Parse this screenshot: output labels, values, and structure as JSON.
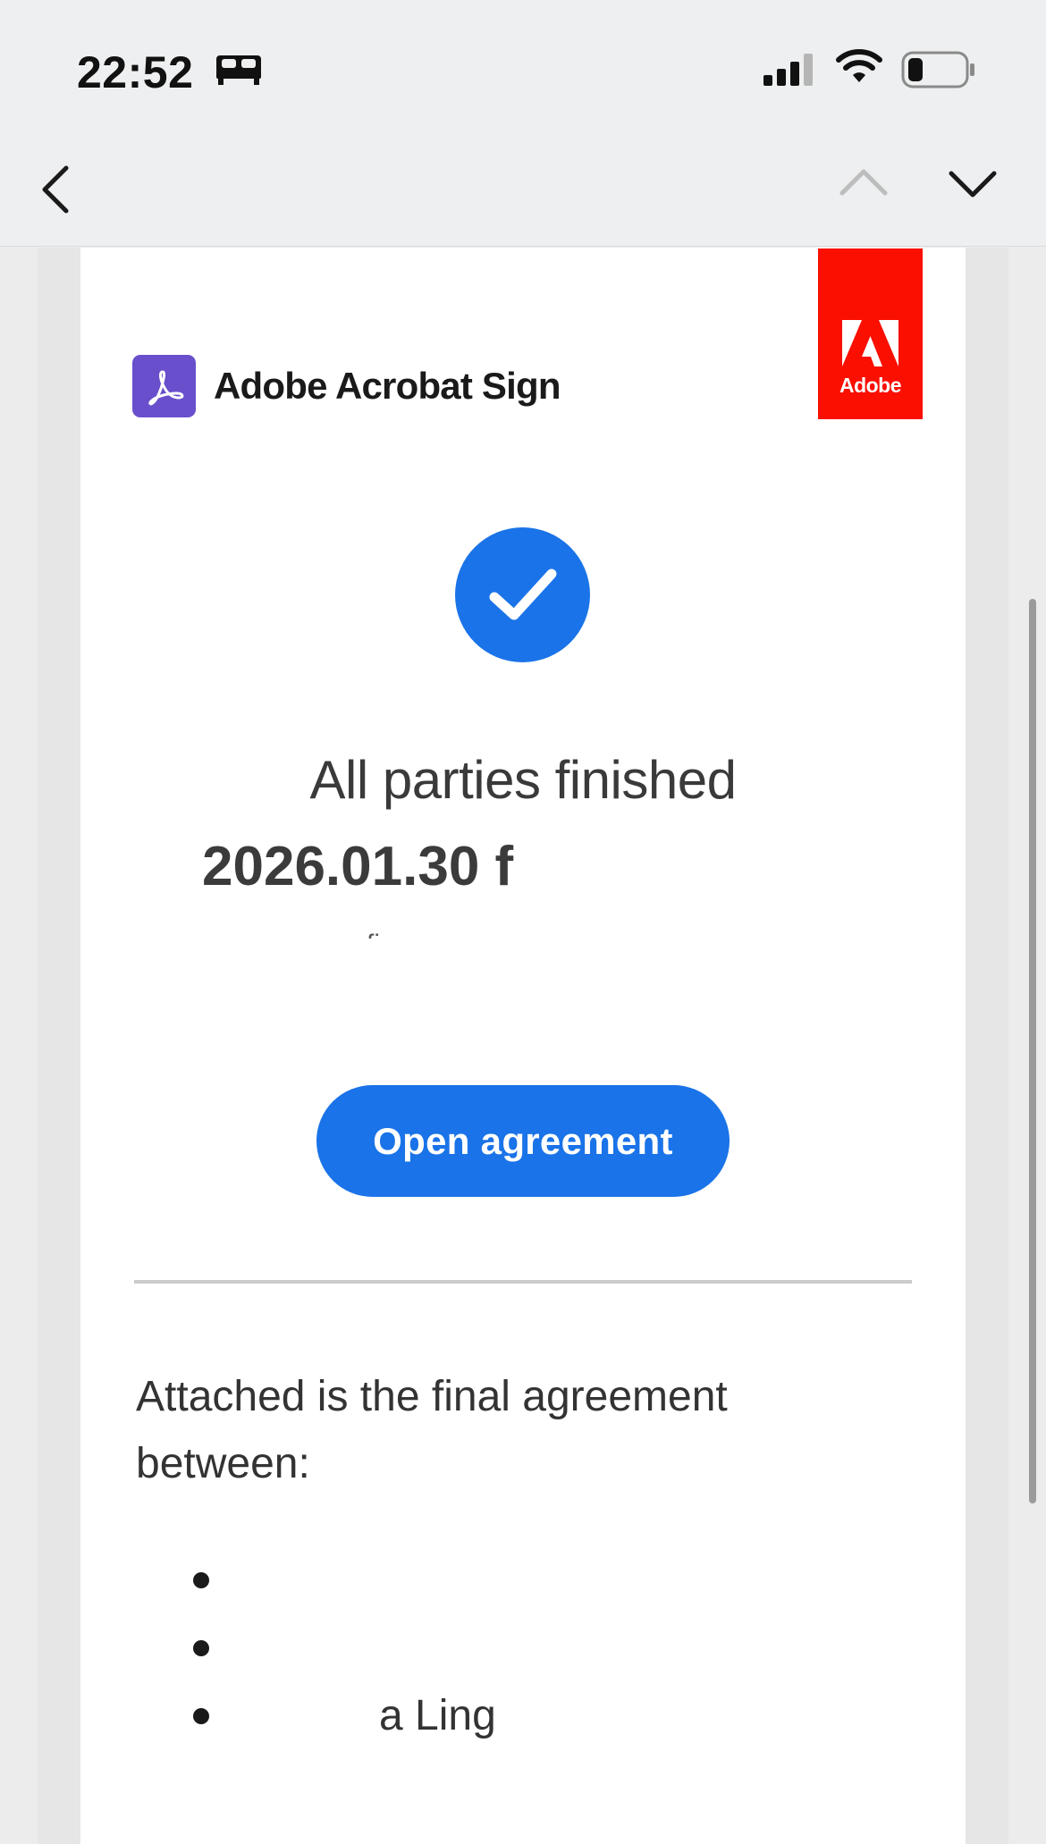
{
  "status_bar": {
    "time": "22:52"
  },
  "nav": {
    "back_icon": "chevron-left-icon",
    "prev_icon": "chevron-up-icon",
    "next_icon": "chevron-down-icon"
  },
  "email": {
    "brand_name": "Adobe Acrobat Sign",
    "adobe_logo_text": "Adobe",
    "status_title": "All parties finished",
    "agreement_name": "2026.01.30 f",
    "agreement_name_line2": "fi",
    "open_button_label": "Open agreement",
    "intro_text": "Attached is the final agreement between:",
    "parties": [
      {
        "name": ""
      },
      {
        "name": ""
      },
      {
        "name": "a Ling"
      }
    ]
  },
  "colors": {
    "accent": "#1a73e8",
    "adobe_red": "#fa0f00",
    "acrobat_purple": "#6a4fcc"
  }
}
